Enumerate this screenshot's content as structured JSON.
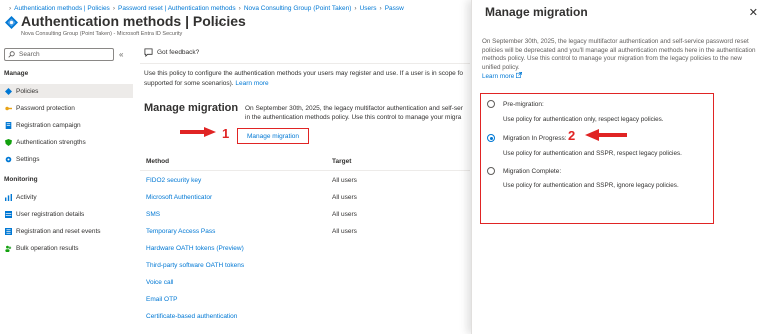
{
  "breadcrumb": {
    "items": [
      "Authentication methods | Policies",
      "Password reset | Authentication methods",
      "Nova Consulting Group (Point Taken)",
      "Users",
      "Passw"
    ]
  },
  "header": {
    "title": "Authentication methods | Policies",
    "subtitle": "Nova Consulting Group (Point Taken) - Microsoft Entra ID Security",
    "more": "..."
  },
  "sidebar": {
    "search_placeholder": "Search",
    "collapse": "«",
    "manage_header": "Manage",
    "manage_items": [
      {
        "label": "Policies",
        "icon": "diamond-icon",
        "active": true
      },
      {
        "label": "Password protection",
        "icon": "key-icon"
      },
      {
        "label": "Registration campaign",
        "icon": "document-icon"
      },
      {
        "label": "Authentication strengths",
        "icon": "shield-icon"
      },
      {
        "label": "Settings",
        "icon": "gear-icon"
      }
    ],
    "monitoring_header": "Monitoring",
    "monitoring_items": [
      {
        "label": "Activity",
        "icon": "chart-icon"
      },
      {
        "label": "User registration details",
        "icon": "table-icon"
      },
      {
        "label": "Registration and reset events",
        "icon": "list-icon"
      },
      {
        "label": "Bulk operation results",
        "icon": "people-icon"
      }
    ]
  },
  "main": {
    "feedback_label": "Got feedback?",
    "intro_line1": "Use this policy to configure the authentication methods your users may register and use. If a user is in scope fo",
    "intro_line2": "supported for some scenarios).",
    "intro_learn_more": "Learn more",
    "migration_heading": "Manage migration",
    "migration_text_line1": "On September 30th, 2025, the legacy multifactor authentication and self-ser",
    "migration_text_line2": "in the authentication methods policy. Use this control to manage your migra",
    "migration_button": "Manage migration",
    "annotation_1": "1",
    "table": {
      "headers": [
        "Method",
        "Target"
      ],
      "rows": [
        {
          "method": "FIDO2 security key",
          "target": "All users"
        },
        {
          "method": "Microsoft Authenticator",
          "target": "All users"
        },
        {
          "method": "SMS",
          "target": "All users"
        },
        {
          "method": "Temporary Access Pass",
          "target": "All users"
        },
        {
          "method": "Hardware OATH tokens (Preview)",
          "target": ""
        },
        {
          "method": "Third-party software OATH tokens",
          "target": ""
        },
        {
          "method": "Voice call",
          "target": ""
        },
        {
          "method": "Email OTP",
          "target": ""
        },
        {
          "method": "Certificate-based authentication",
          "target": ""
        }
      ]
    }
  },
  "panel": {
    "title": "Manage migration",
    "close": "✕",
    "description": "On September 30th, 2025, the legacy multifactor authentication and self-service password reset policies will be deprecated and you'll manage all authentication methods here in the authentication methods policy. Use this control to manage your migration from the legacy policies to the new unified policy.",
    "learn_more": "Learn more",
    "annotation_2": "2",
    "options": [
      {
        "label": "Pre-migration:",
        "desc": "Use policy for authentication only, respect legacy policies.",
        "checked": false
      },
      {
        "label": "Migration In Progress:",
        "desc": "Use policy for authentication and SSPR, respect legacy policies.",
        "checked": true
      },
      {
        "label": "Migration Complete:",
        "desc": "Use policy for authentication and SSPR, ignore legacy policies.",
        "checked": false
      }
    ]
  },
  "colors": {
    "accent": "#0078d4",
    "annotation": "#e02424",
    "active_nav": "#edebe9"
  }
}
